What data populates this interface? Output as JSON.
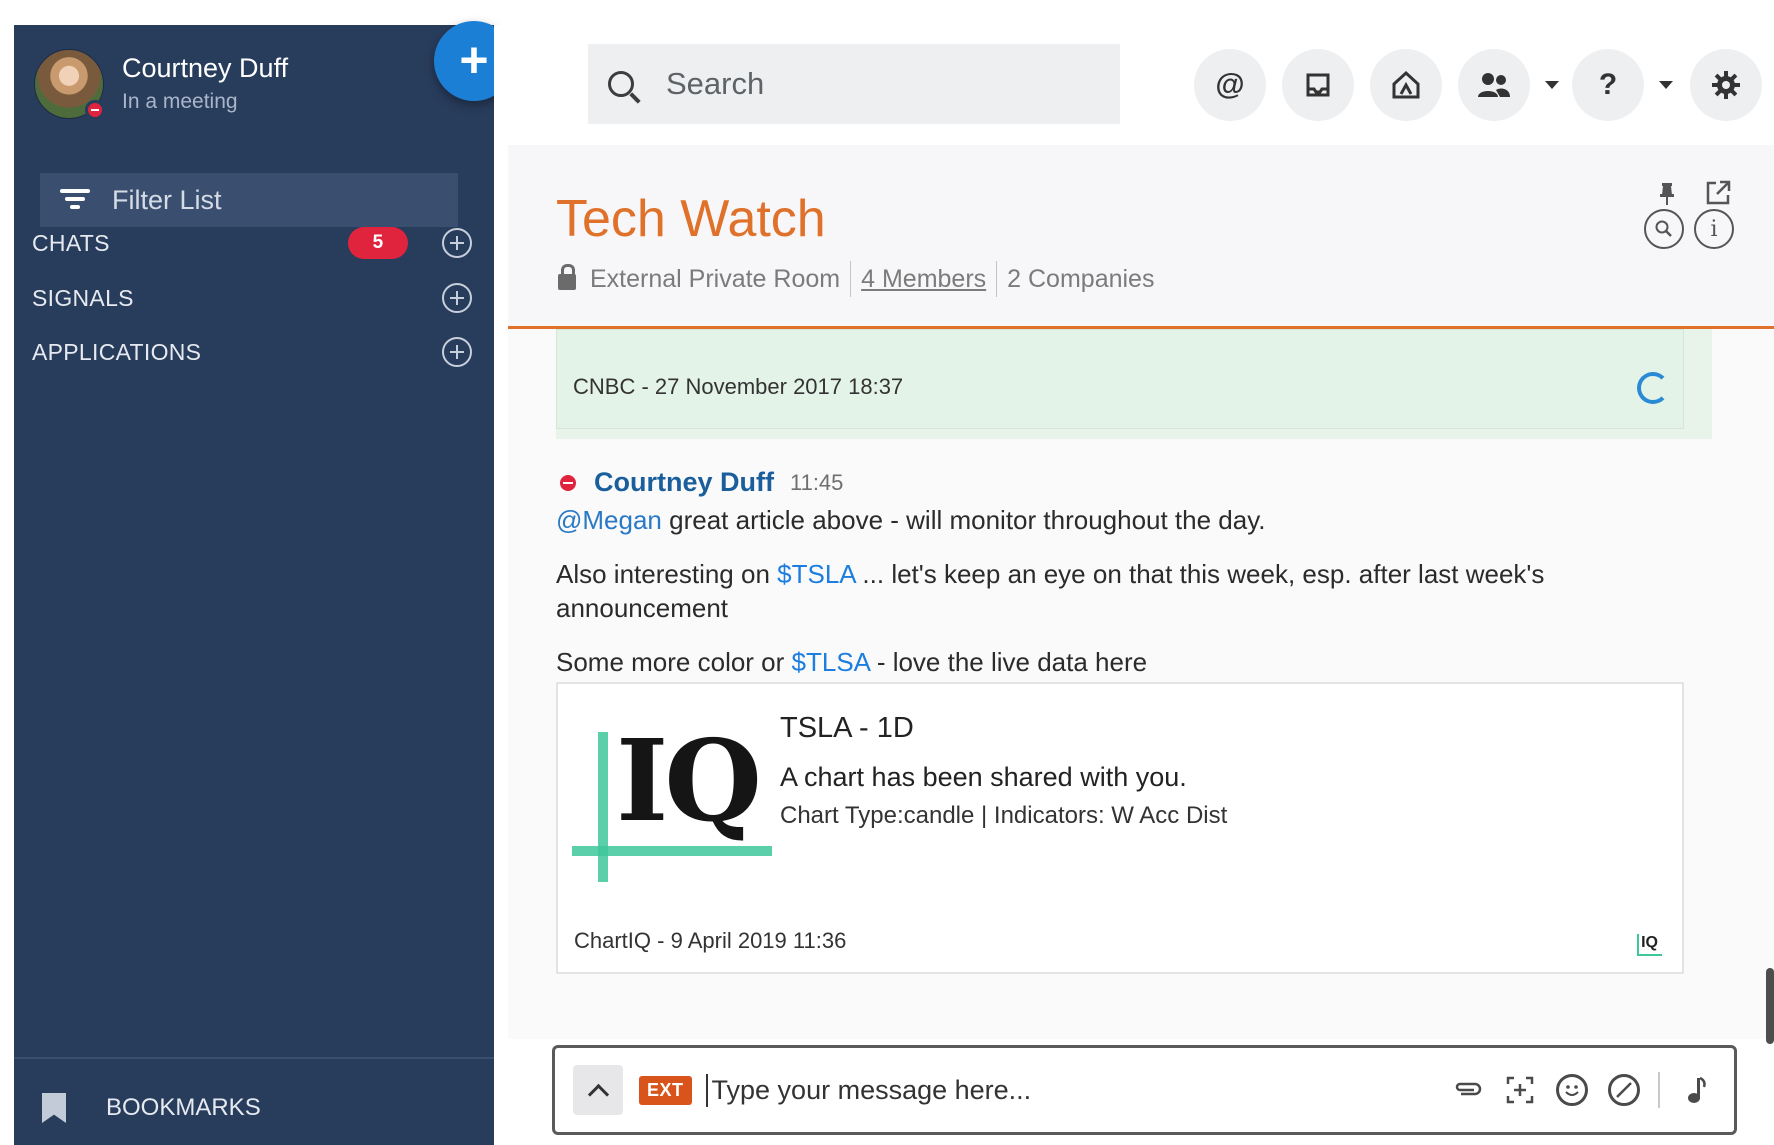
{
  "user": {
    "name": "Courtney Duff",
    "status": "In a meeting"
  },
  "sidebar": {
    "filter_placeholder": "Filter List",
    "sections": [
      {
        "label": "CHATS",
        "badge": "5"
      },
      {
        "label": "SIGNALS"
      },
      {
        "label": "APPLICATIONS"
      }
    ],
    "bookmarks_label": "BOOKMARKS"
  },
  "search": {
    "placeholder": "Search"
  },
  "topbar_icons": [
    "at-mention-icon",
    "inbox-icon",
    "home-icon",
    "people-icon",
    "help-icon",
    "settings-icon"
  ],
  "topbar": {
    "at_symbol": "@",
    "help_symbol": "?"
  },
  "room": {
    "title": "Tech Watch",
    "type": "External Private Room",
    "members": "4 Members",
    "companies": "2 Companies"
  },
  "article_card": {
    "footer": "CNBC - 27 November 2017 18:37"
  },
  "message": {
    "author": "Courtney Duff",
    "time": "11:45",
    "line1": {
      "mention": "@Megan",
      "text": " great article above - will monitor throughout the day."
    },
    "line2": {
      "prefix": "Also interesting on ",
      "cashtag": "$TSLA",
      "suffix": " ... let's keep an eye on that this week, esp. after last week's announcement"
    },
    "line3": {
      "prefix": "Some more color or ",
      "cashtag": "$TLSA",
      "suffix": " - love the live data here"
    }
  },
  "chart_card": {
    "logo_text": "IQ",
    "title": "TSLA - 1D",
    "subtitle": "A chart has been shared with you.",
    "description": "Chart Type:candle | Indicators: W Acc Dist",
    "footer": "ChartIQ - 9 April 2019 11:36",
    "mini_logo": "IQ"
  },
  "composer": {
    "ext_label": "EXT",
    "placeholder": "Type your message here..."
  },
  "colors": {
    "sidebar_bg": "#283c5c",
    "accent_orange": "#e0712a",
    "badge_red": "#e0243d",
    "fab_blue": "#1b7fd6",
    "link_blue": "#2a79c4",
    "card_green": "#e4f3e8"
  }
}
